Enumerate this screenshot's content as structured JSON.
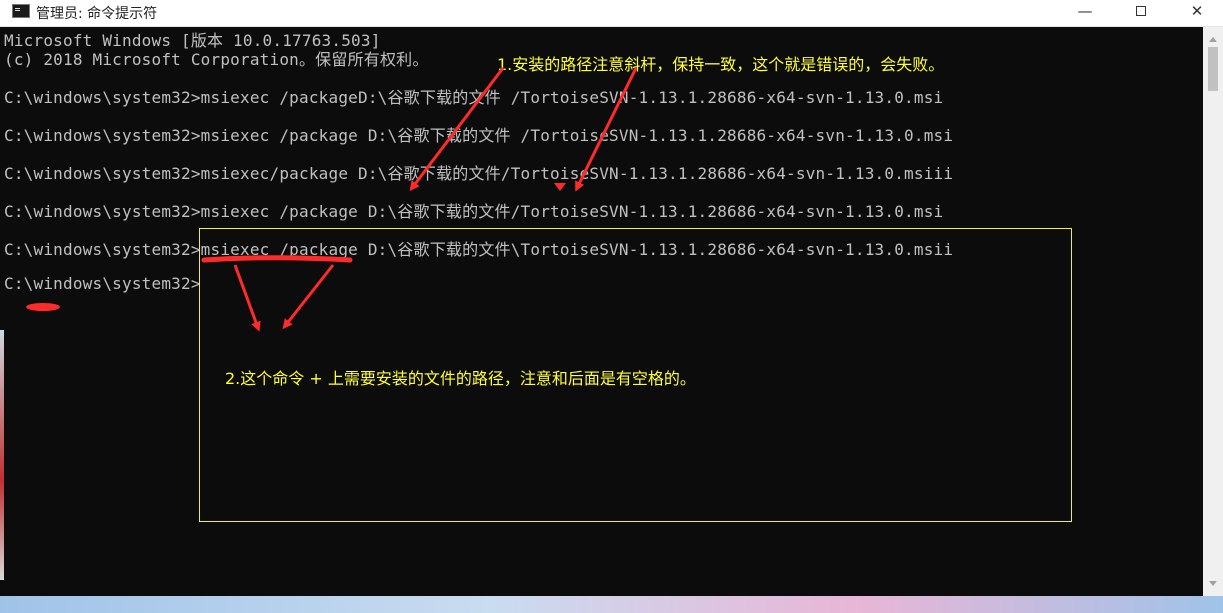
{
  "window": {
    "title": "管理员: 命令提示符",
    "controls": {
      "minimize": "—",
      "close": "✕"
    }
  },
  "console": {
    "lines": [
      "Microsoft Windows [版本 10.0.17763.503]",
      "(c) 2018 Microsoft Corporation。保留所有权利。",
      "C:\\windows\\system32>msiexec /packageD:\\谷歌下载的文件 /TortoiseSVN-1.13.1.28686-x64-svn-1.13.0.msi",
      "C:\\windows\\system32>msiexec /package D:\\谷歌下载的文件 /TortoiseSVN-1.13.1.28686-x64-svn-1.13.0.msi",
      "C:\\windows\\system32>msiexec/package D:\\谷歌下载的文件/TortoiseSVN-1.13.1.28686-x64-svn-1.13.0.msiii",
      "C:\\windows\\system32>msiexec /package D:\\谷歌下载的文件/TortoiseSVN-1.13.1.28686-x64-svn-1.13.0.msi",
      "C:\\windows\\system32>msiexec /package D:\\谷歌下载的文件\\TortoiseSVN-1.13.1.28686-x64-svn-1.13.0.msii",
      "C:\\windows\\system32>"
    ]
  },
  "annotations": {
    "note1": "1.安装的路径注意斜杆，保持一致，这个就是错误的，会失败。",
    "note2": "2.这个命令 + 上需要安装的文件的路径，注意和后面是有空格的。"
  },
  "colors": {
    "annotation": "#ffff33",
    "arrow": "#ff2a2a",
    "console_bg": "#0c0c0c",
    "console_text": "#c0c0c0"
  }
}
